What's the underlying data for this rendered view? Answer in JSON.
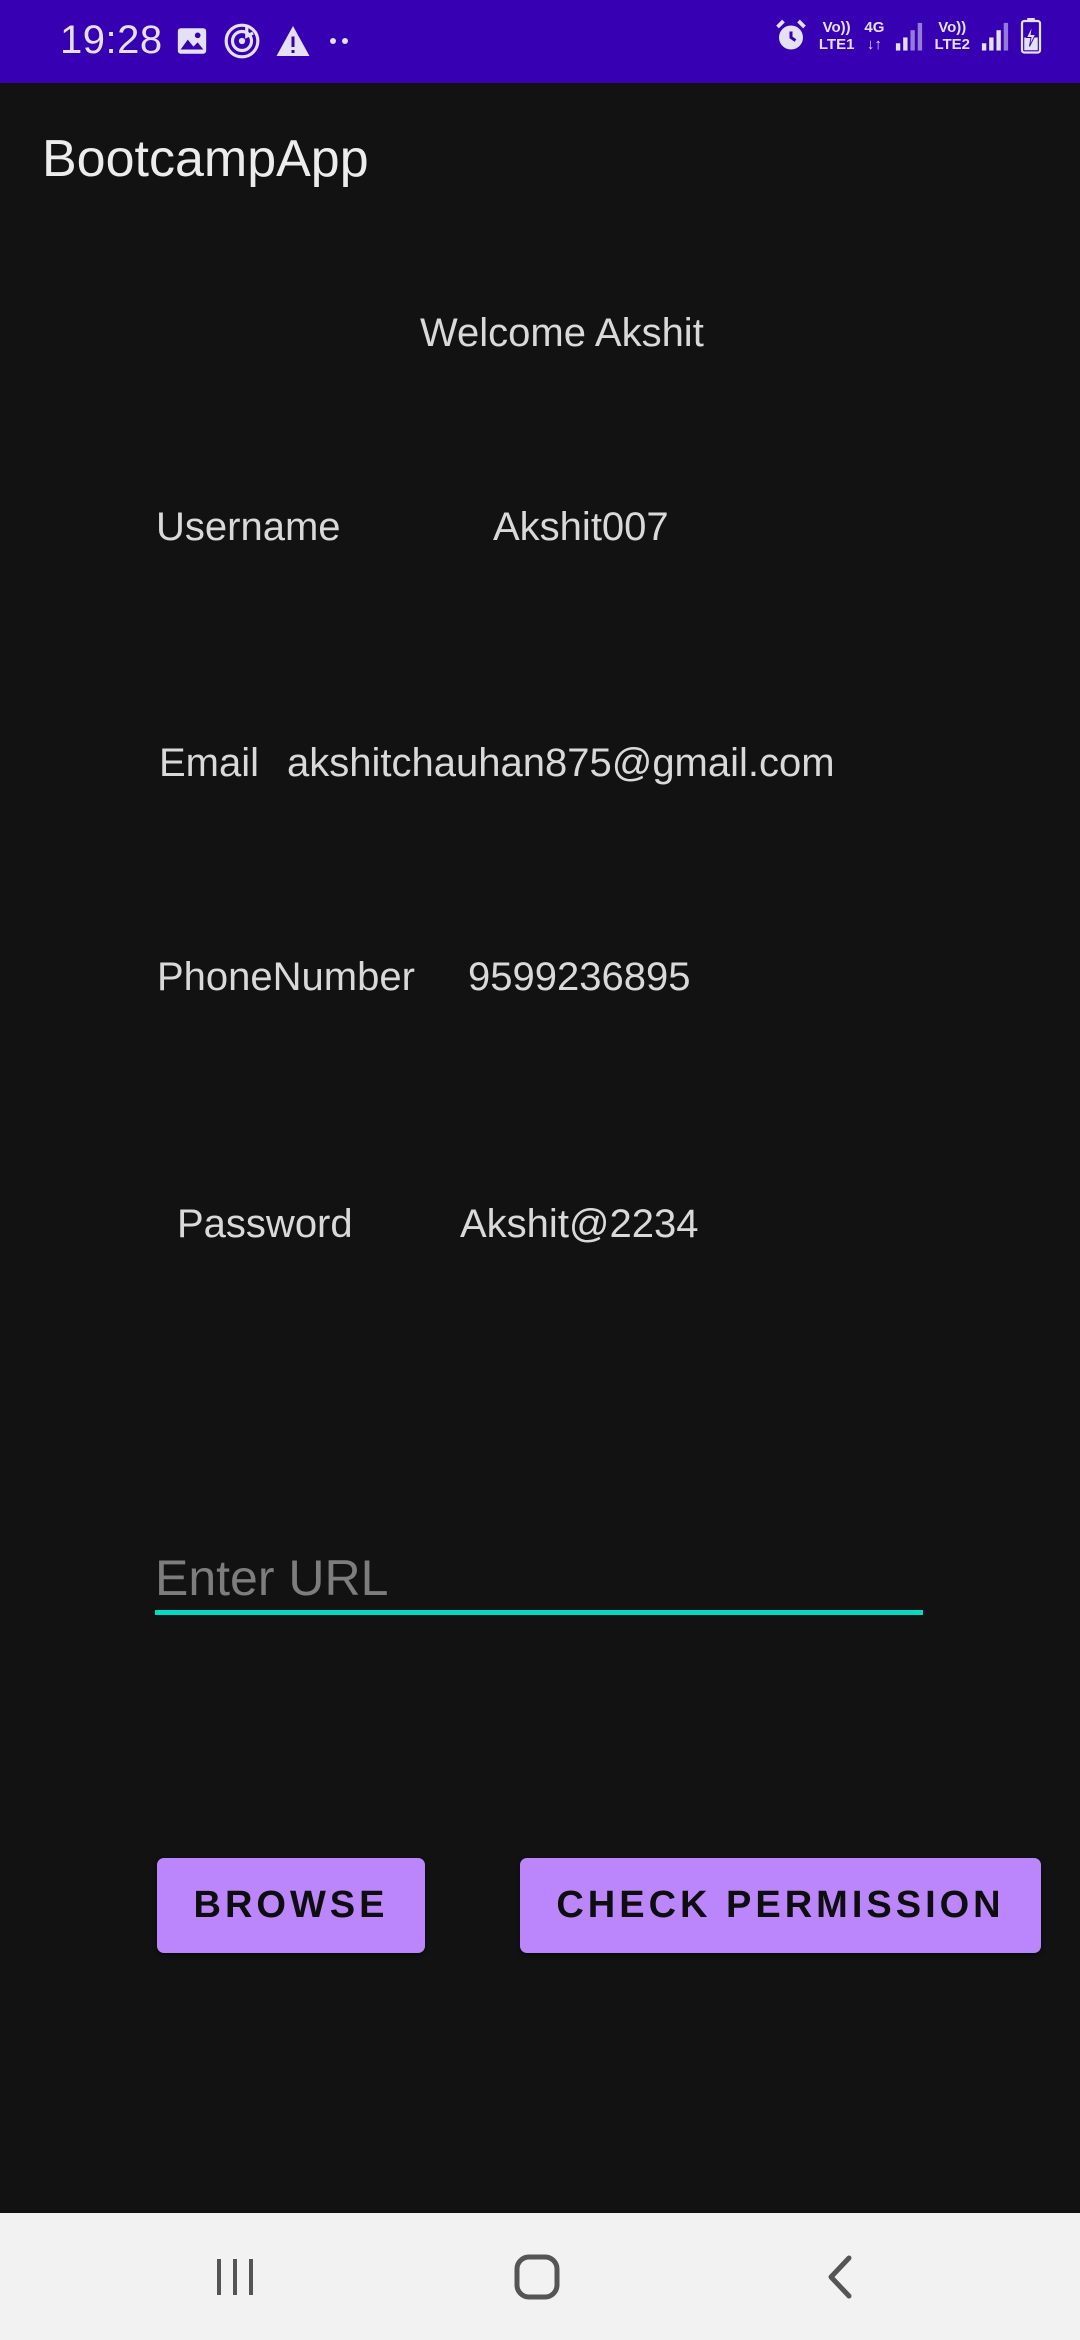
{
  "status_bar": {
    "time": "19:28",
    "left_icons": [
      "image-icon",
      "music-icon",
      "alert-icon",
      "more-dots-icon"
    ],
    "right_icons": [
      "alarm-icon",
      "volte1-icon",
      "data-4g-icon",
      "signal1-icon",
      "volte2-icon",
      "signal2-icon",
      "battery-charging-icon"
    ],
    "volte1_top": "Vo))",
    "volte1_bottom": "LTE1",
    "data_label": "4G",
    "volte2_top": "Vo))",
    "volte2_bottom": "LTE2",
    "bg_color": "#3700b3"
  },
  "app_bar": {
    "title": "BootcampApp"
  },
  "profile": {
    "welcome": "Welcome Akshit",
    "username_label": "Username",
    "username_value": "Akshit007",
    "email_label": "Email",
    "email_value": "akshitchauhan875@gmail.com",
    "phone_label": "PhoneNumber",
    "phone_value": "9599236895",
    "password_label": "Password",
    "password_value": "Akshit@2234"
  },
  "url_input": {
    "value": "",
    "placeholder": "Enter URL",
    "underline_color": "#03dac5"
  },
  "buttons": {
    "browse_label": "BROWSE",
    "check_permission_label": "CHECK PERMISSION",
    "color": "#bb86fc"
  },
  "nav_bar": {
    "recents_icon": "recents-icon",
    "home_icon": "home-icon",
    "back_icon": "back-icon"
  }
}
